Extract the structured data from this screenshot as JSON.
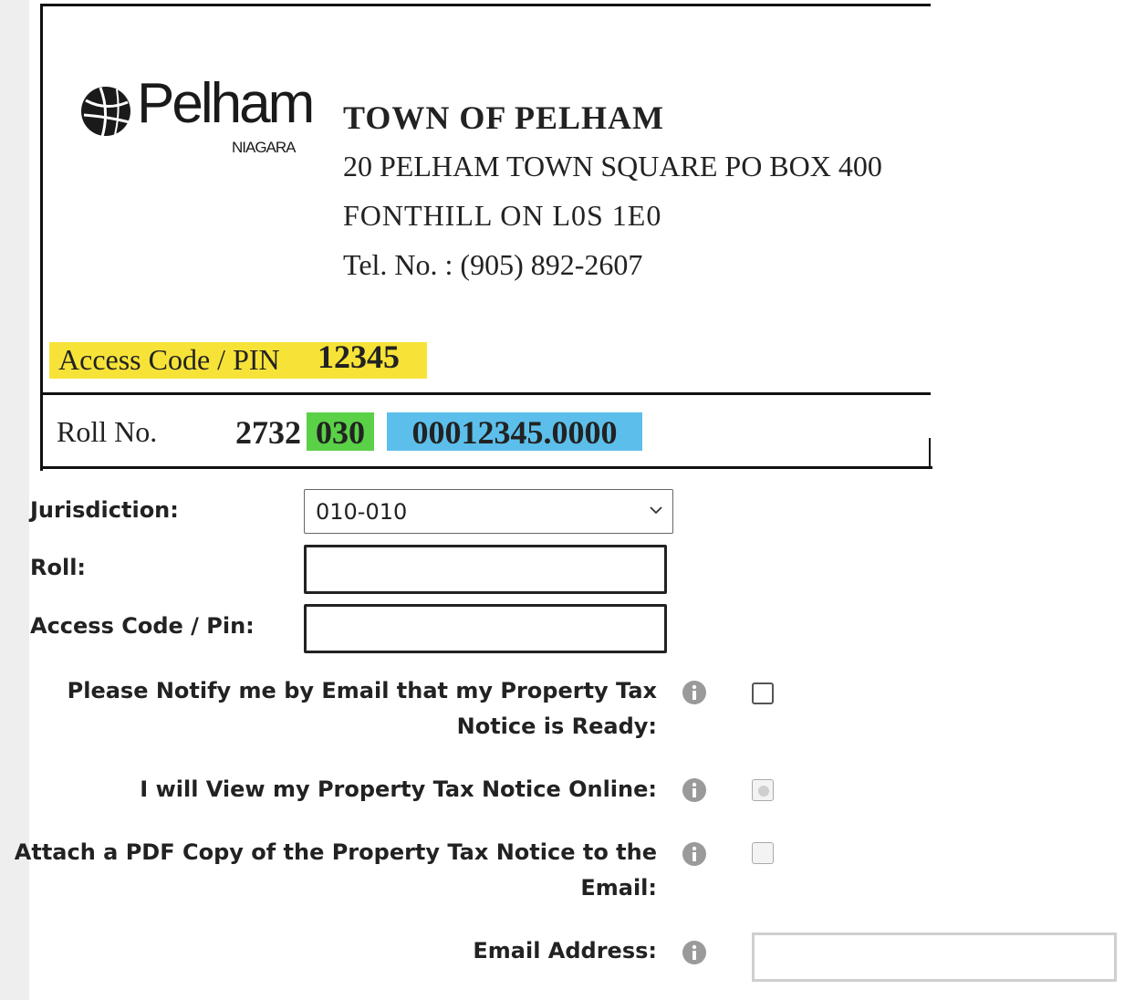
{
  "notice": {
    "logo": {
      "name": "Pelham",
      "sub": "NIAGARA"
    },
    "town_name": "TOWN OF PELHAM",
    "address_line1": "20 PELHAM TOWN SQUARE PO BOX 400",
    "address_line2": "FONTHILL ON L0S 1E0",
    "phone": "Tel. No. : (905) 892-2607",
    "pin_label": "Access Code / PIN",
    "pin_value": "12345",
    "roll_label": "Roll No.",
    "roll_part1": "2732",
    "roll_part2": "030",
    "roll_part3": "00012345.0000",
    "colors": {
      "pin_highlight": "#f7e338",
      "jurisdiction_highlight": "#5ad146",
      "roll_highlight": "#5cbfeb"
    }
  },
  "form": {
    "jurisdiction_label": "Jurisdiction:",
    "jurisdiction_value": "010-010",
    "roll_label": "Roll:",
    "roll_value": "",
    "pin_label": "Access Code / Pin:",
    "pin_value": "",
    "notify_label_line1": "Please Notify me by Email that my Property Tax",
    "notify_label_line2": "Notice is Ready:",
    "view_online_label": "I will View my Property Tax Notice Online:",
    "attach_pdf_label_line1": "Attach a PDF Copy of the Property Tax Notice to the",
    "attach_pdf_label_line2": "Email:",
    "email_label": "Email Address:",
    "email_value": ""
  },
  "icons": [
    "info-icon",
    "chevron-down-icon",
    "pelham-logo-icon"
  ]
}
